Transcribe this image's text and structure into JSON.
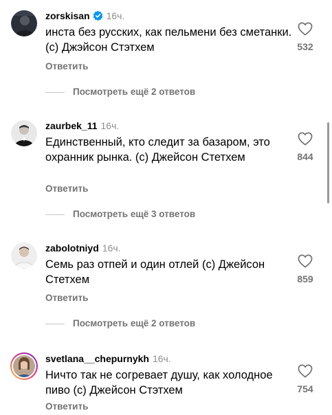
{
  "comments": [
    {
      "username": "zorskisan",
      "verified": true,
      "time": "16ч.",
      "text": "инста без русских, как пельмени без сметанки. (с) Джэйсон Стэтхем",
      "likes": "532",
      "reply_label": "Ответить",
      "more_replies": "Посмотреть ещё 2 ответов",
      "avatar_icon": "avatar-dark-person-icon"
    },
    {
      "username": "zaurbek_11",
      "verified": false,
      "time": "16ч.",
      "text": "Единственный, кто следит за базаром, это охранник рынка. (с) Джейсон Стетхем",
      "likes": "844",
      "reply_label": "Ответить",
      "more_replies": "Посмотреть ещё 3 ответов",
      "avatar_icon": "avatar-suit-man-icon"
    },
    {
      "username": "zabolotniyd",
      "verified": false,
      "time": "16ч.",
      "text": "Семь раз отпей и один отлей (с) Джейсон Стетхем",
      "likes": "859",
      "reply_label": "Ответить",
      "more_replies": "Посмотреть ещё 2 ответов",
      "avatar_icon": "avatar-light-person-icon"
    },
    {
      "username": "svetlana__chepurnykh",
      "verified": false,
      "time": "16ч.",
      "text": "Ничто так не согревает душу, как холодное пиво (с) Джейсон Стэтхем",
      "likes": "754",
      "reply_label": "Ответить",
      "avatar_icon": "avatar-woman-story-ring-icon"
    }
  ],
  "colors": {
    "text": "#000000",
    "secondary": "#737373",
    "time": "#8e8e8e",
    "verified": "#0095f6",
    "story_ring_start": "#f9ce34",
    "story_ring_end": "#ee2a7b"
  }
}
